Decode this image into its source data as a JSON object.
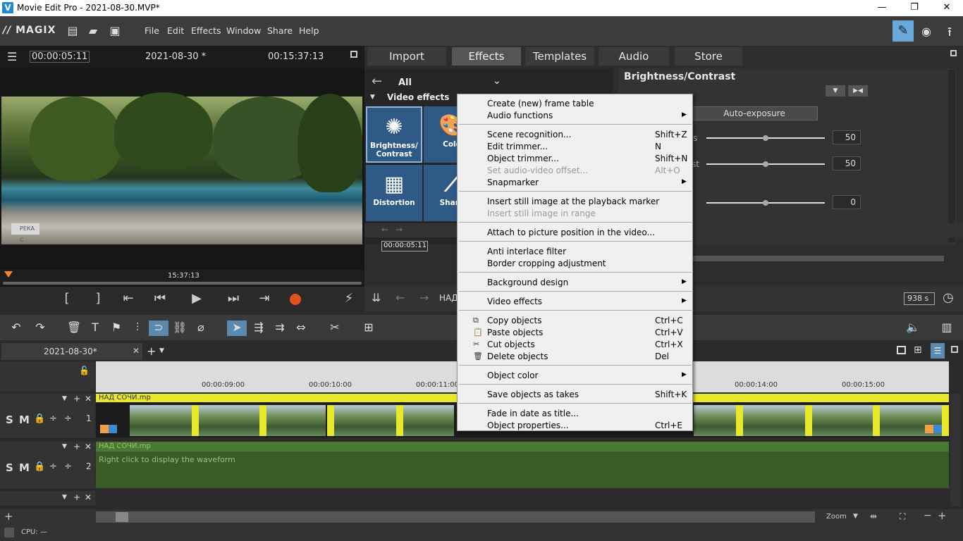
{
  "window": {
    "title": "Movie Edit Pro - 2021-08-30.MVP*",
    "minimize": "—",
    "restore": "❐",
    "close": "✕"
  },
  "menubar": {
    "brand": "MAGIX",
    "items": [
      "File",
      "Edit",
      "Effects",
      "Window",
      "Share",
      "Help"
    ]
  },
  "preview": {
    "current_time": "00:00:05:11",
    "project": "2021-08-30 *",
    "total_time": "00:15:37:13",
    "overlay_text": "РЕКА С",
    "scrub_time": "15:37:13"
  },
  "tabs": [
    "Import",
    "Effects",
    "Templates",
    "Audio",
    "Store"
  ],
  "effects": {
    "category": "All",
    "section": "Video effects",
    "tiles": [
      "Brightness/ Contrast",
      "Colo",
      "Distortion",
      "Sharp"
    ],
    "time": "00:00:05:11"
  },
  "props": {
    "title": "Brightness/Contrast",
    "auto_btn": "Auto-exposure",
    "s_label": "s",
    "t_label": "st",
    "values": [
      "50",
      "50",
      "0"
    ]
  },
  "panelbottom": {
    "nad": "НАД",
    "duration": "938 s"
  },
  "project_tab": {
    "name": "2021-08-30*",
    "add": "+"
  },
  "ruler": {
    "labels": [
      "00:00:09:00",
      "00:00:10:00",
      "00:00:11:00",
      "00:00:14:00",
      "00:00:15:00"
    ]
  },
  "tracks": {
    "video_label": "НАД СОЧИ.mp",
    "audio_label": "НАД СОЧИ.mp",
    "audio_hint": "Right click to display the waveform",
    "num1": "1",
    "num2": "2",
    "s": "S",
    "m": "M"
  },
  "zoom": "Zoom",
  "status": {
    "cpu": "CPU: —"
  },
  "context_menu": [
    {
      "label": "Create (new) frame table",
      "shortcut": "",
      "sub": false,
      "dis": false
    },
    {
      "label": "Audio functions",
      "shortcut": "",
      "sub": true,
      "dis": false
    },
    {
      "sep": true
    },
    {
      "label": "Scene recognition...",
      "shortcut": "Shift+Z",
      "sub": false,
      "dis": false
    },
    {
      "label": "Edit trimmer...",
      "shortcut": "N",
      "sub": false,
      "dis": false
    },
    {
      "label": "Object trimmer...",
      "shortcut": "Shift+N",
      "sub": false,
      "dis": false
    },
    {
      "label": "Set audio-video offset...",
      "shortcut": "Alt+O",
      "sub": false,
      "dis": true
    },
    {
      "label": "Snapmarker",
      "shortcut": "",
      "sub": true,
      "dis": false
    },
    {
      "sep": true
    },
    {
      "label": "Insert still image at the playback marker",
      "shortcut": "",
      "sub": false,
      "dis": false
    },
    {
      "label": "Insert still image in range",
      "shortcut": "",
      "sub": false,
      "dis": true
    },
    {
      "sep": true
    },
    {
      "label": "Attach to picture position in the video...",
      "shortcut": "",
      "sub": false,
      "dis": false
    },
    {
      "sep": true
    },
    {
      "label": "Anti interlace filter",
      "shortcut": "",
      "sub": false,
      "dis": false
    },
    {
      "label": "Border cropping adjustment",
      "shortcut": "",
      "sub": false,
      "dis": false
    },
    {
      "sep": true
    },
    {
      "label": "Background design",
      "shortcut": "",
      "sub": true,
      "dis": false
    },
    {
      "sep": true
    },
    {
      "label": "Video effects",
      "shortcut": "",
      "sub": true,
      "dis": false
    },
    {
      "sep": true
    },
    {
      "label": "Copy objects",
      "shortcut": "Ctrl+C",
      "sub": false,
      "dis": false,
      "icon": "copy-icon"
    },
    {
      "label": "Paste objects",
      "shortcut": "Ctrl+V",
      "sub": false,
      "dis": false,
      "icon": "paste-icon"
    },
    {
      "label": "Cut objects",
      "shortcut": "Ctrl+X",
      "sub": false,
      "dis": false,
      "icon": "cut-icon"
    },
    {
      "label": "Delete objects",
      "shortcut": "Del",
      "sub": false,
      "dis": false,
      "icon": "trash-icon"
    },
    {
      "sep": true
    },
    {
      "label": "Object color",
      "shortcut": "",
      "sub": true,
      "dis": false
    },
    {
      "sep": true
    },
    {
      "label": "Save objects as takes",
      "shortcut": "Shift+K",
      "sub": false,
      "dis": false
    },
    {
      "sep": true
    },
    {
      "label": "Fade in date as title...",
      "shortcut": "",
      "sub": false,
      "dis": false
    },
    {
      "label": "Object properties...",
      "shortcut": "Ctrl+E",
      "sub": false,
      "dis": false
    }
  ]
}
